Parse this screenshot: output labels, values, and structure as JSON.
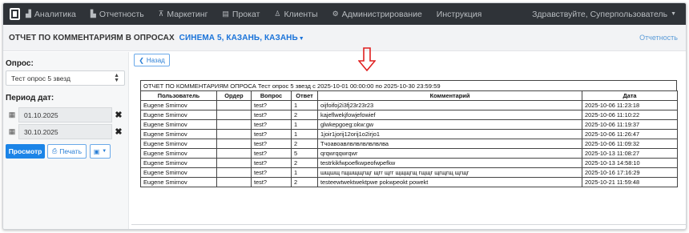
{
  "nav": {
    "items": [
      {
        "label": "Аналитика",
        "icon": "chart-icon"
      },
      {
        "label": "Отчетность",
        "icon": "bar-chart-icon"
      },
      {
        "label": "Маркетинг",
        "icon": "cart-icon"
      },
      {
        "label": "Прокат",
        "icon": "film-icon"
      },
      {
        "label": "Клиенты",
        "icon": "users-icon"
      },
      {
        "label": "Администрирование",
        "icon": "gears-icon"
      },
      {
        "label": "Инструкция",
        "icon": ""
      }
    ],
    "greeting": "Здравствуйте, Суперпользователь"
  },
  "header": {
    "title": "ОТЧЕТ ПО КОММЕНТАРИЯМ В ОПРОСАХ",
    "cinema": "СИНЕМА 5, КАЗАНЬ, КАЗАНЬ",
    "right_link": "Отчетность"
  },
  "sidebar": {
    "survey_label": "Опрос:",
    "survey_value": "Тест опрос 5 звезд",
    "period_label": "Период дат:",
    "date_from": "01.10.2025",
    "date_to": "30.10.2025",
    "view_button": "Просмотр",
    "print_button": "Печать"
  },
  "main": {
    "back_button": "Назад",
    "report_title": "ОТЧЕТ ПО КОММЕНТАРИЯМ ОПРОСА Тест опрос 5 звезд с 2025-10-01 00:00:00 по 2025-10-30 23:59:59",
    "columns": [
      "Пользователь",
      "Ордер",
      "Вопрос",
      "Ответ",
      "Комментарий",
      "Дата"
    ],
    "rows": [
      [
        "Eugene Smirnov",
        "",
        "test?",
        "1",
        "oijfoifoj2i3fj23r23r23",
        "2025-10-06 11:23:18"
      ],
      [
        "Eugene Smirnov",
        "",
        "test?",
        "2",
        "kajeflwekjfowjefowief",
        "2025-10-06 11:10:22"
      ],
      [
        "Eugene Smirnov",
        "",
        "test?",
        "1",
        "glwkepgoeg:okw:gw",
        "2025-10-06 11:19:37"
      ],
      [
        "Eugene Smirnov",
        "",
        "test?",
        "1",
        "1joir1jorij12orij1o2irjo1",
        "2025-10-06 11:26:47"
      ],
      [
        "Eugene Smirnov",
        "",
        "test?",
        "2",
        "Тчоавоавлвлвлвлвлвлва",
        "2025-10-06 11:09:32"
      ],
      [
        "Eugene Smirnov",
        "",
        "test?",
        "5",
        "qrqwrqqwrqwr",
        "2025-10-13 11:08:27"
      ],
      [
        "Eugene Smirnov",
        "",
        "test?",
        "2",
        "testrkikfwpoefkwpeofwpefkw",
        "2025-10-13 14:58:10"
      ],
      [
        "Eugene Smirnov",
        "",
        "test?",
        "1",
        "шщшщ гщшщщгщг щгг щгг щщщгщ гщщг щгщгщ щгщг",
        "2025-10-16 17:16:29"
      ],
      [
        "Eugene Smirnov",
        "",
        "test?",
        "2",
        "testeewtwektwektpwe pokwpeokt powekt",
        "2025-10-21 11:59:48"
      ]
    ]
  }
}
